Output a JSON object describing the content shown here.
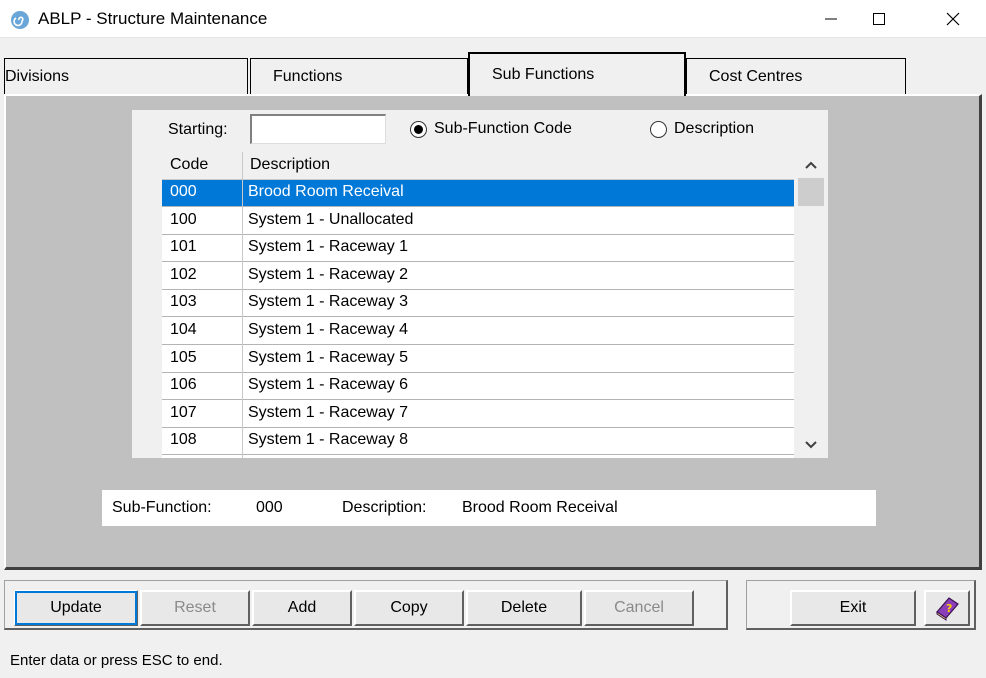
{
  "window": {
    "title": "ABLP - Structure Maintenance",
    "icon": "app-spiral-icon",
    "controls": [
      "minimize-icon",
      "maximize-icon",
      "close-icon"
    ]
  },
  "tabs": [
    {
      "label": "Divisions",
      "active": false
    },
    {
      "label": "Functions",
      "active": false
    },
    {
      "label": "Sub Functions",
      "active": true
    },
    {
      "label": "Cost Centres",
      "active": false
    }
  ],
  "search": {
    "starting_label": "Starting:",
    "starting_value": "",
    "options": [
      {
        "label": "Sub-Function Code",
        "selected": true
      },
      {
        "label": "Description",
        "selected": false
      }
    ]
  },
  "list": {
    "columns": [
      "Code",
      "Description"
    ],
    "rows": [
      {
        "code": "000",
        "description": "Brood Room Receival",
        "selected": true
      },
      {
        "code": "100",
        "description": "System 1 - Unallocated",
        "selected": false
      },
      {
        "code": "101",
        "description": "System 1 - Raceway 1",
        "selected": false
      },
      {
        "code": "102",
        "description": "System 1 - Raceway 2",
        "selected": false
      },
      {
        "code": "103",
        "description": "System 1 - Raceway 3",
        "selected": false
      },
      {
        "code": "104",
        "description": "System 1 - Raceway 4",
        "selected": false
      },
      {
        "code": "105",
        "description": "System 1 - Raceway 5",
        "selected": false
      },
      {
        "code": "106",
        "description": "System 1 - Raceway 6",
        "selected": false
      },
      {
        "code": "107",
        "description": "System 1 - Raceway 7",
        "selected": false
      },
      {
        "code": "108",
        "description": "System 1 - Raceway 8",
        "selected": false
      }
    ]
  },
  "detail": {
    "subfunction_label": "Sub-Function:",
    "subfunction_value": "000",
    "description_label": "Description:",
    "description_value": "Brood Room Receival"
  },
  "toolbar": {
    "update": "Update",
    "reset": "Reset",
    "add": "Add",
    "copy": "Copy",
    "delete": "Delete",
    "cancel": "Cancel",
    "exit": "Exit",
    "help_icon": "help-book-icon"
  },
  "status": "Enter data or press ESC to end.",
  "colors": {
    "selection": "#0078d7",
    "panel": "#c0c0c0",
    "face": "#f0f0f0"
  }
}
